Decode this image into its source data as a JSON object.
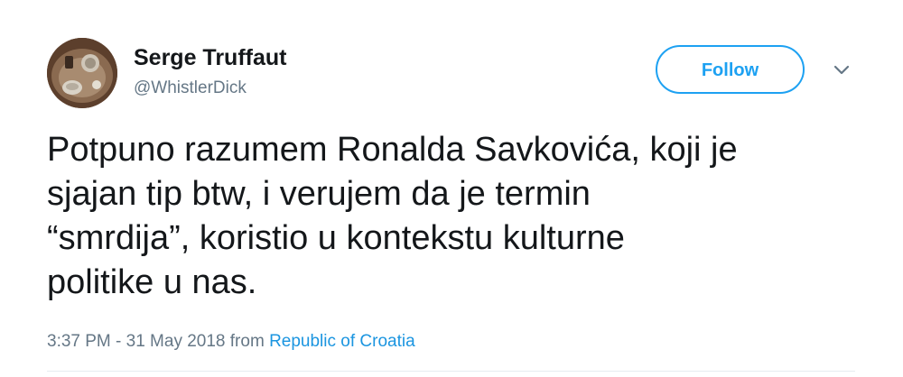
{
  "author": {
    "display_name": "Serge Truffaut",
    "handle": "@WhistlerDick",
    "avatar_icon": "user-avatar"
  },
  "actions": {
    "follow_label": "Follow",
    "more_icon": "chevron-down-icon"
  },
  "tweet": {
    "lines": [
      "Potpuno razumem Ronalda Savkovića, koji je",
      "sjajan tip btw, i verujem da je termin",
      "“smrdija”, koristio u kontekstu kulturne",
      "politike u nas."
    ]
  },
  "meta": {
    "timestamp": "3:37 PM - 31 May 2018",
    "from_label": "from",
    "location": "Republic of Croatia"
  },
  "colors": {
    "accent": "#1da1f2",
    "link": "#1b95e0",
    "text": "#14171a",
    "secondary_text": "#657786",
    "divider": "#e6ecf0"
  }
}
